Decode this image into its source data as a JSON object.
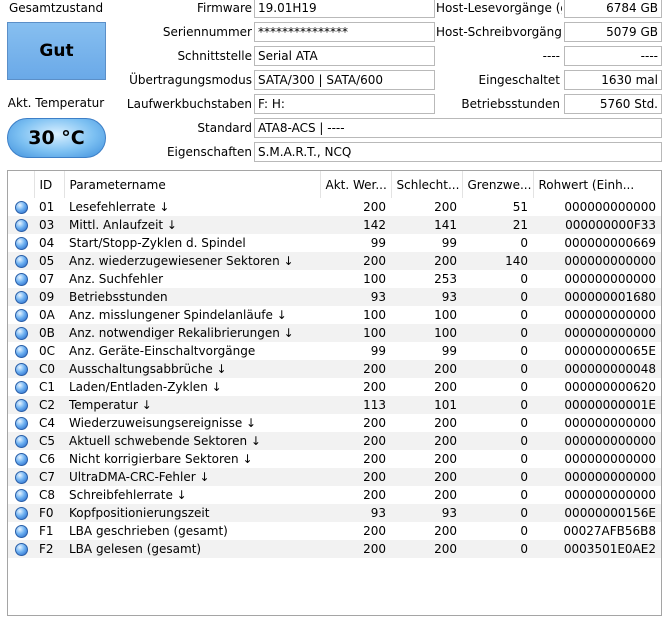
{
  "health": {
    "label": "Gesamtzustand",
    "status": "Gut",
    "status_color": "#76b4ec"
  },
  "temperature": {
    "label": "Akt. Temperatur",
    "value": "30 °C"
  },
  "info": {
    "firmware": {
      "label": "Firmware",
      "value": "19.01H19"
    },
    "serial": {
      "label": "Seriennummer",
      "value": "***************"
    },
    "interface": {
      "label": "Schnittstelle",
      "value": "Serial ATA"
    },
    "transfer_mode": {
      "label": "Übertragungsmodus",
      "value": "SATA/300 | SATA/600"
    },
    "drive_letters": {
      "label": "Laufwerkbuchstaben",
      "value": "F: H:"
    },
    "standard": {
      "label": "Standard",
      "value": "ATA8-ACS | ----"
    },
    "features": {
      "label": "Eigenschaften",
      "value": "S.M.A.R.T., NCQ"
    }
  },
  "stats": {
    "host_reads": {
      "label": "Host-Lesevorgänge (ge",
      "value": "6784 GB"
    },
    "host_writes": {
      "label": "Host-Schreibvorgänge (",
      "value": "5079 GB"
    },
    "blank": {
      "label": "----",
      "value": "----"
    },
    "power_on_count": {
      "label": "Eingeschaltet",
      "value": "1630 mal"
    },
    "power_on_hours": {
      "label": "Betriebsstunden",
      "value": "5760 Std."
    }
  },
  "table": {
    "headers": [
      "",
      "ID",
      "Parametername",
      "Akt. Wer...",
      "Schlecht...",
      "Grenzwe...",
      "Rohwert (Einh..."
    ],
    "rows": [
      {
        "id": "01",
        "name": "Lesefehlerrate ↓",
        "current": "200",
        "worst": "200",
        "threshold": "51",
        "raw": "000000000000"
      },
      {
        "id": "03",
        "name": "Mittl. Anlaufzeit ↓",
        "current": "142",
        "worst": "141",
        "threshold": "21",
        "raw": "000000000F33"
      },
      {
        "id": "04",
        "name": "Start/Stopp-Zyklen d. Spindel",
        "current": "99",
        "worst": "99",
        "threshold": "0",
        "raw": "000000000669"
      },
      {
        "id": "05",
        "name": "Anz. wiederzugewiesener Sektoren ↓",
        "current": "200",
        "worst": "200",
        "threshold": "140",
        "raw": "000000000000"
      },
      {
        "id": "07",
        "name": "Anz. Suchfehler",
        "current": "100",
        "worst": "253",
        "threshold": "0",
        "raw": "000000000000"
      },
      {
        "id": "09",
        "name": "Betriebsstunden",
        "current": "93",
        "worst": "93",
        "threshold": "0",
        "raw": "000000001680"
      },
      {
        "id": "0A",
        "name": "Anz. misslungener Spindelanläufe ↓",
        "current": "100",
        "worst": "100",
        "threshold": "0",
        "raw": "000000000000"
      },
      {
        "id": "0B",
        "name": "Anz. notwendiger Rekalibrierungen ↓",
        "current": "100",
        "worst": "100",
        "threshold": "0",
        "raw": "000000000000"
      },
      {
        "id": "0C",
        "name": "Anz. Geräte-Einschaltvorgänge",
        "current": "99",
        "worst": "99",
        "threshold": "0",
        "raw": "00000000065E"
      },
      {
        "id": "C0",
        "name": "Ausschaltungsabbrüche ↓",
        "current": "200",
        "worst": "200",
        "threshold": "0",
        "raw": "000000000048"
      },
      {
        "id": "C1",
        "name": "Laden/Entladen-Zyklen ↓",
        "current": "200",
        "worst": "200",
        "threshold": "0",
        "raw": "000000000620"
      },
      {
        "id": "C2",
        "name": "Temperatur ↓",
        "current": "113",
        "worst": "101",
        "threshold": "0",
        "raw": "00000000001E"
      },
      {
        "id": "C4",
        "name": "Wiederzuweisungsereignisse ↓",
        "current": "200",
        "worst": "200",
        "threshold": "0",
        "raw": "000000000000"
      },
      {
        "id": "C5",
        "name": "Aktuell schwebende Sektoren ↓",
        "current": "200",
        "worst": "200",
        "threshold": "0",
        "raw": "000000000000"
      },
      {
        "id": "C6",
        "name": "Nicht korrigierbare Sektoren ↓",
        "current": "200",
        "worst": "200",
        "threshold": "0",
        "raw": "000000000000"
      },
      {
        "id": "C7",
        "name": "UltraDMA-CRC-Fehler ↓",
        "current": "200",
        "worst": "200",
        "threshold": "0",
        "raw": "000000000000"
      },
      {
        "id": "C8",
        "name": "Schreibfehlerrate ↓",
        "current": "200",
        "worst": "200",
        "threshold": "0",
        "raw": "000000000000"
      },
      {
        "id": "F0",
        "name": "Kopfpositionierungszeit",
        "current": "93",
        "worst": "93",
        "threshold": "0",
        "raw": "00000000156E"
      },
      {
        "id": "F1",
        "name": "LBA geschrieben (gesamt)",
        "current": "200",
        "worst": "200",
        "threshold": "0",
        "raw": "00027AFB56B8"
      },
      {
        "id": "F2",
        "name": "LBA gelesen (gesamt)",
        "current": "200",
        "worst": "200",
        "threshold": "0",
        "raw": "0003501E0AE2"
      }
    ]
  }
}
